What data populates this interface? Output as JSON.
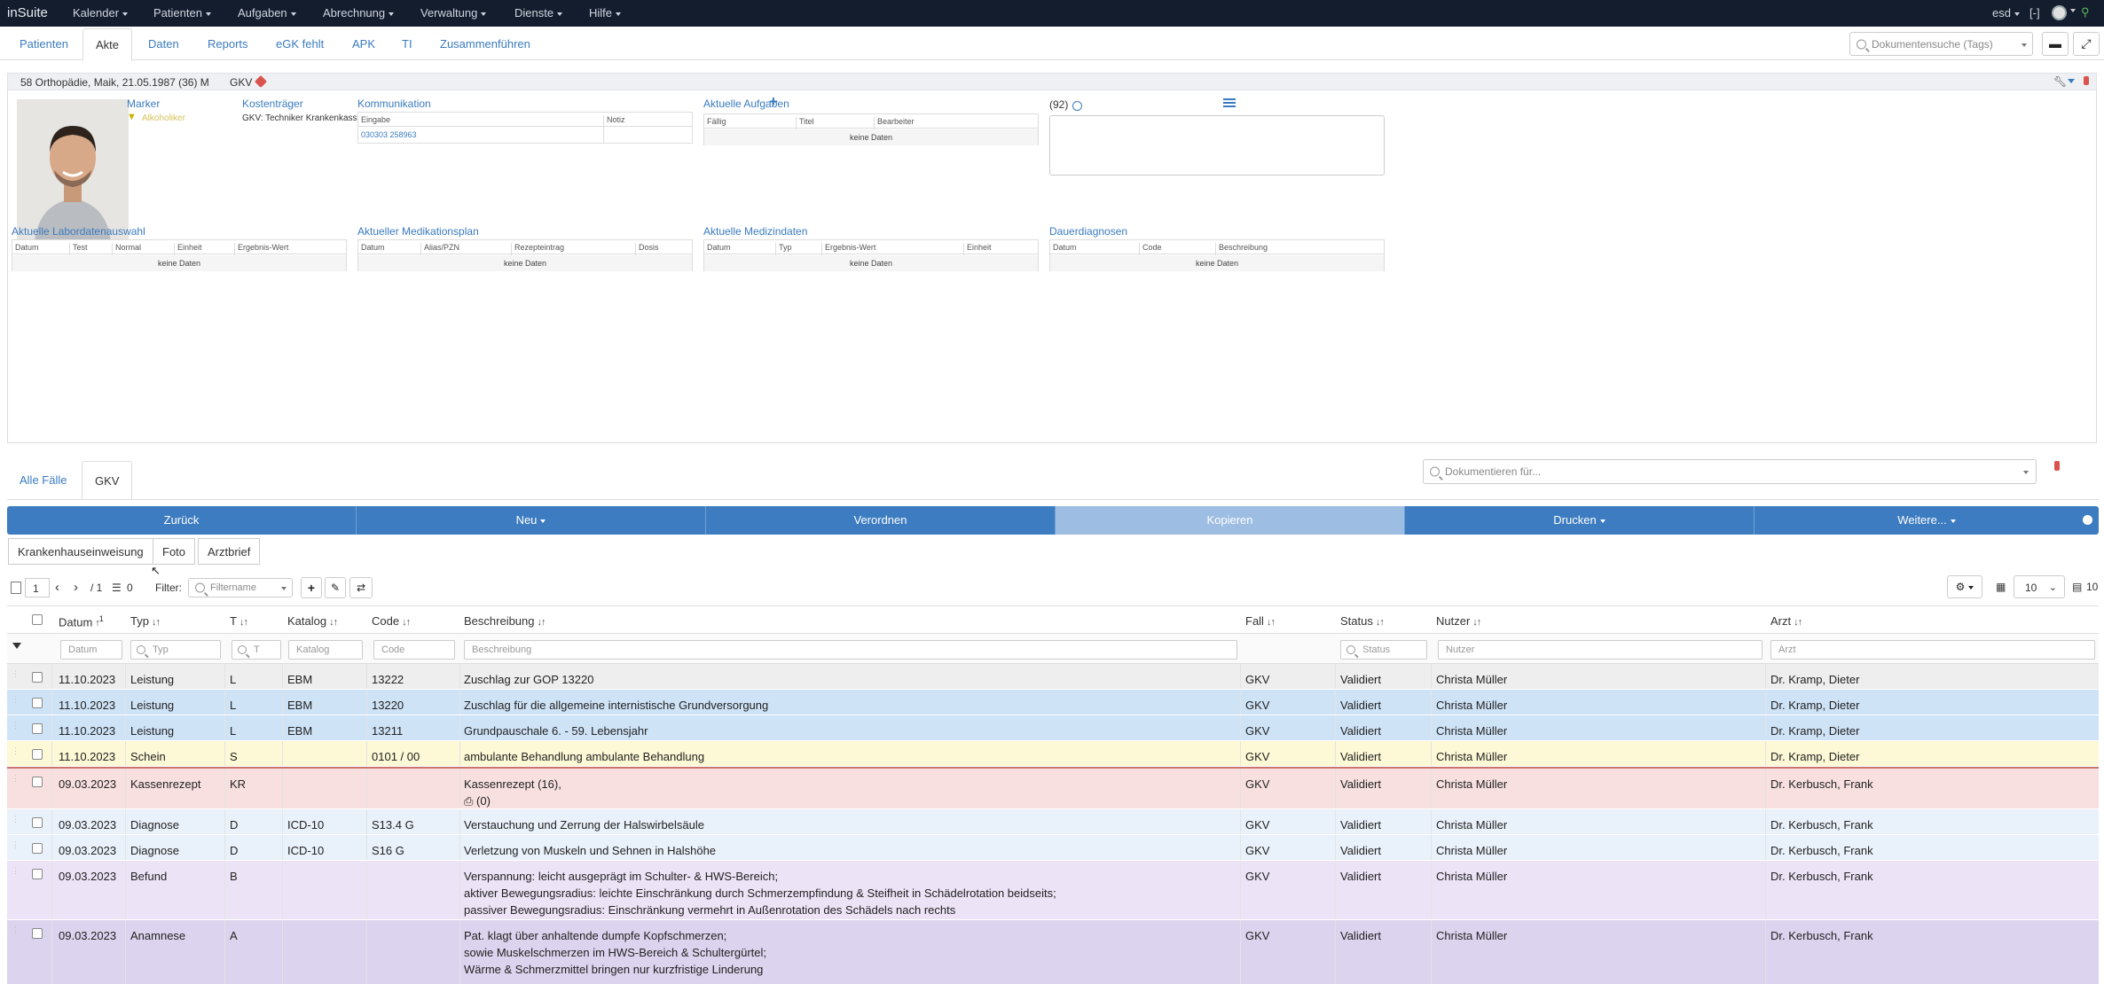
{
  "navbar": {
    "brand": "inSuite",
    "menu": [
      "Kalender",
      "Patienten",
      "Aufgaben",
      "Abrechnung",
      "Verwaltung",
      "Dienste",
      "Hilfe"
    ],
    "user": "esd",
    "bracket": "[-]"
  },
  "patient_tabs": [
    "Patienten",
    "Akte",
    "Daten",
    "Reports",
    "eGK fehlt",
    "APK",
    "TI",
    "Zusammenführen"
  ],
  "doc_search": {
    "placeholder": "Dokumentensuche (Tags)"
  },
  "patient": {
    "header": "58 Orthopädie, Maik, 21.05.1987 (36) M",
    "insurance": "GKV",
    "marker_label": "Marker",
    "marker_value": "Alkoholiker",
    "kostentraeger_label": "Kostenträger",
    "kostentraeger_value": "GKV: Techniker Krankenkasse",
    "kommunikation_label": "Kommunikation",
    "kommunikation_cols": [
      "Eingabe",
      "Notiz"
    ],
    "kommunikation_value": "030303 258963",
    "aufgaben_label": "Aktuelle Aufgaben",
    "aufgaben_cols": [
      "Fällig",
      "Titel",
      "Bearbeiter"
    ],
    "no_data": "keine Daten",
    "count": "(92)",
    "labor_label": "Aktuelle Labordatenauswahl",
    "labor_cols": [
      "Datum",
      "Test",
      "Normal",
      "Einheit",
      "Ergebnis-Wert"
    ],
    "medplan_label": "Aktueller Medikationsplan",
    "medplan_cols": [
      "Datum",
      "Alias/PZN",
      "Rezepteintrag",
      "Dosis"
    ],
    "medizin_label": "Aktuelle Medizindaten",
    "medizin_cols": [
      "Datum",
      "Typ",
      "Ergebnis-Wert",
      "Einheit"
    ],
    "dauer_label": "Dauerdiagnosen",
    "dauer_cols": [
      "Datum",
      "Code",
      "Beschreibung"
    ]
  },
  "case_tabs": [
    "Alle Fälle",
    "GKV"
  ],
  "doc_for": {
    "placeholder": "Dokumentieren für..."
  },
  "actions": [
    "Zurück",
    "Neu",
    "Verordnen",
    "Kopieren",
    "Drucken",
    "Weitere..."
  ],
  "subtabs": [
    "Krankenhauseinweisung",
    "Foto",
    "Arztbrief"
  ],
  "toolbar": {
    "page": "1",
    "of": "/ 1",
    "count": "0",
    "filter_label": "Filter:",
    "filter_placeholder": "Filtername",
    "page_size": "10",
    "total": "10"
  },
  "grid": {
    "columns": [
      "Datum",
      "Typ",
      "T",
      "Katalog",
      "Code",
      "Beschreibung",
      "Fall",
      "Status",
      "Nutzer",
      "Arzt"
    ],
    "date_sort_index": "1",
    "filters": [
      "Datum",
      "Typ",
      "T",
      "Katalog",
      "Code",
      "Beschreibung",
      "Status",
      "Nutzer",
      "Arzt"
    ],
    "rows": [
      {
        "datum": "11.10.2023",
        "typ": "Leistung",
        "t": "L",
        "katalog": "EBM",
        "code": "13222",
        "beschreibung": [
          "Zuschlag zur GOP 13220"
        ],
        "fall": "GKV",
        "status": "Validiert",
        "nutzer": "Christa Müller",
        "arzt": "Dr. Kramp, Dieter",
        "color": "#eeeeee"
      },
      {
        "datum": "11.10.2023",
        "typ": "Leistung",
        "t": "L",
        "katalog": "EBM",
        "code": "13220",
        "beschreibung": [
          "Zuschlag für die allgemeine internistische Grundversorgung"
        ],
        "fall": "GKV",
        "status": "Validiert",
        "nutzer": "Christa Müller",
        "arzt": "Dr. Kramp, Dieter",
        "color": "#cfe3f7"
      },
      {
        "datum": "11.10.2023",
        "typ": "Leistung",
        "t": "L",
        "katalog": "EBM",
        "code": "13211",
        "beschreibung": [
          "Grundpauschale 6. - 59. Lebensjahr"
        ],
        "fall": "GKV",
        "status": "Validiert",
        "nutzer": "Christa Müller",
        "arzt": "Dr. Kramp, Dieter",
        "color": "#cfe3f7"
      },
      {
        "datum": "11.10.2023",
        "typ": "Schein",
        "t": "S",
        "katalog": "",
        "code": "0101 / 00",
        "beschreibung": [
          "ambulante Behandlung ambulante Behandlung"
        ],
        "fall": "GKV",
        "status": "Validiert",
        "nutzer": "Christa Müller",
        "arzt": "Dr. Kramp, Dieter",
        "color": "#fdf8d5"
      },
      {
        "datum": "09.03.2023",
        "typ": "Kassenrezept",
        "t": "KR",
        "katalog": "",
        "code": "",
        "beschreibung": [
          "Kassenrezept (16),",
          "(0)"
        ],
        "fall": "GKV",
        "status": "Validiert",
        "nutzer": "Christa Müller",
        "arzt": "Dr. Kerbusch, Frank",
        "color": "#f8e0e0"
      },
      {
        "datum": "09.03.2023",
        "typ": "Diagnose",
        "t": "D",
        "katalog": "ICD-10",
        "code": "S13.4 G",
        "beschreibung": [
          "Verstauchung und Zerrung der Halswirbelsäule"
        ],
        "fall": "GKV",
        "status": "Validiert",
        "nutzer": "Christa Müller",
        "arzt": "Dr. Kerbusch, Frank",
        "color": "#e9f1fa"
      },
      {
        "datum": "09.03.2023",
        "typ": "Diagnose",
        "t": "D",
        "katalog": "ICD-10",
        "code": "S16 G",
        "beschreibung": [
          "Verletzung von Muskeln und Sehnen in Halshöhe"
        ],
        "fall": "GKV",
        "status": "Validiert",
        "nutzer": "Christa Müller",
        "arzt": "Dr. Kerbusch, Frank",
        "color": "#e9f1fa"
      },
      {
        "datum": "09.03.2023",
        "typ": "Befund",
        "t": "B",
        "katalog": "",
        "code": "",
        "beschreibung": [
          "Verspannung: leicht ausgeprägt im Schulter- & HWS-Bereich;",
          "aktiver Bewegungsradius: leichte Einschränkung durch Schmerzempfindung & Steifheit in Schädelrotation beidseits;",
          "passiver Bewegungsradius: Einschränkung vermehrt in Außenrotation des Schädels nach rechts"
        ],
        "fall": "GKV",
        "status": "Validiert",
        "nutzer": "Christa Müller",
        "arzt": "Dr. Kerbusch, Frank",
        "color": "#ece3f6"
      },
      {
        "datum": "09.03.2023",
        "typ": "Anamnese",
        "t": "A",
        "katalog": "",
        "code": "",
        "beschreibung": [
          "Pat. klagt über anhaltende dumpfe Kopfschmerzen;",
          "sowie Muskelschmerzen im HWS-Bereich & Schultergürtel;",
          "Wärme & Schmerzmittel bringen nur kurzfristige Linderung"
        ],
        "fall": "GKV",
        "status": "Validiert",
        "nutzer": "Christa Müller",
        "arzt": "Dr. Kerbusch, Frank",
        "color": "#dcd3ee"
      }
    ]
  }
}
